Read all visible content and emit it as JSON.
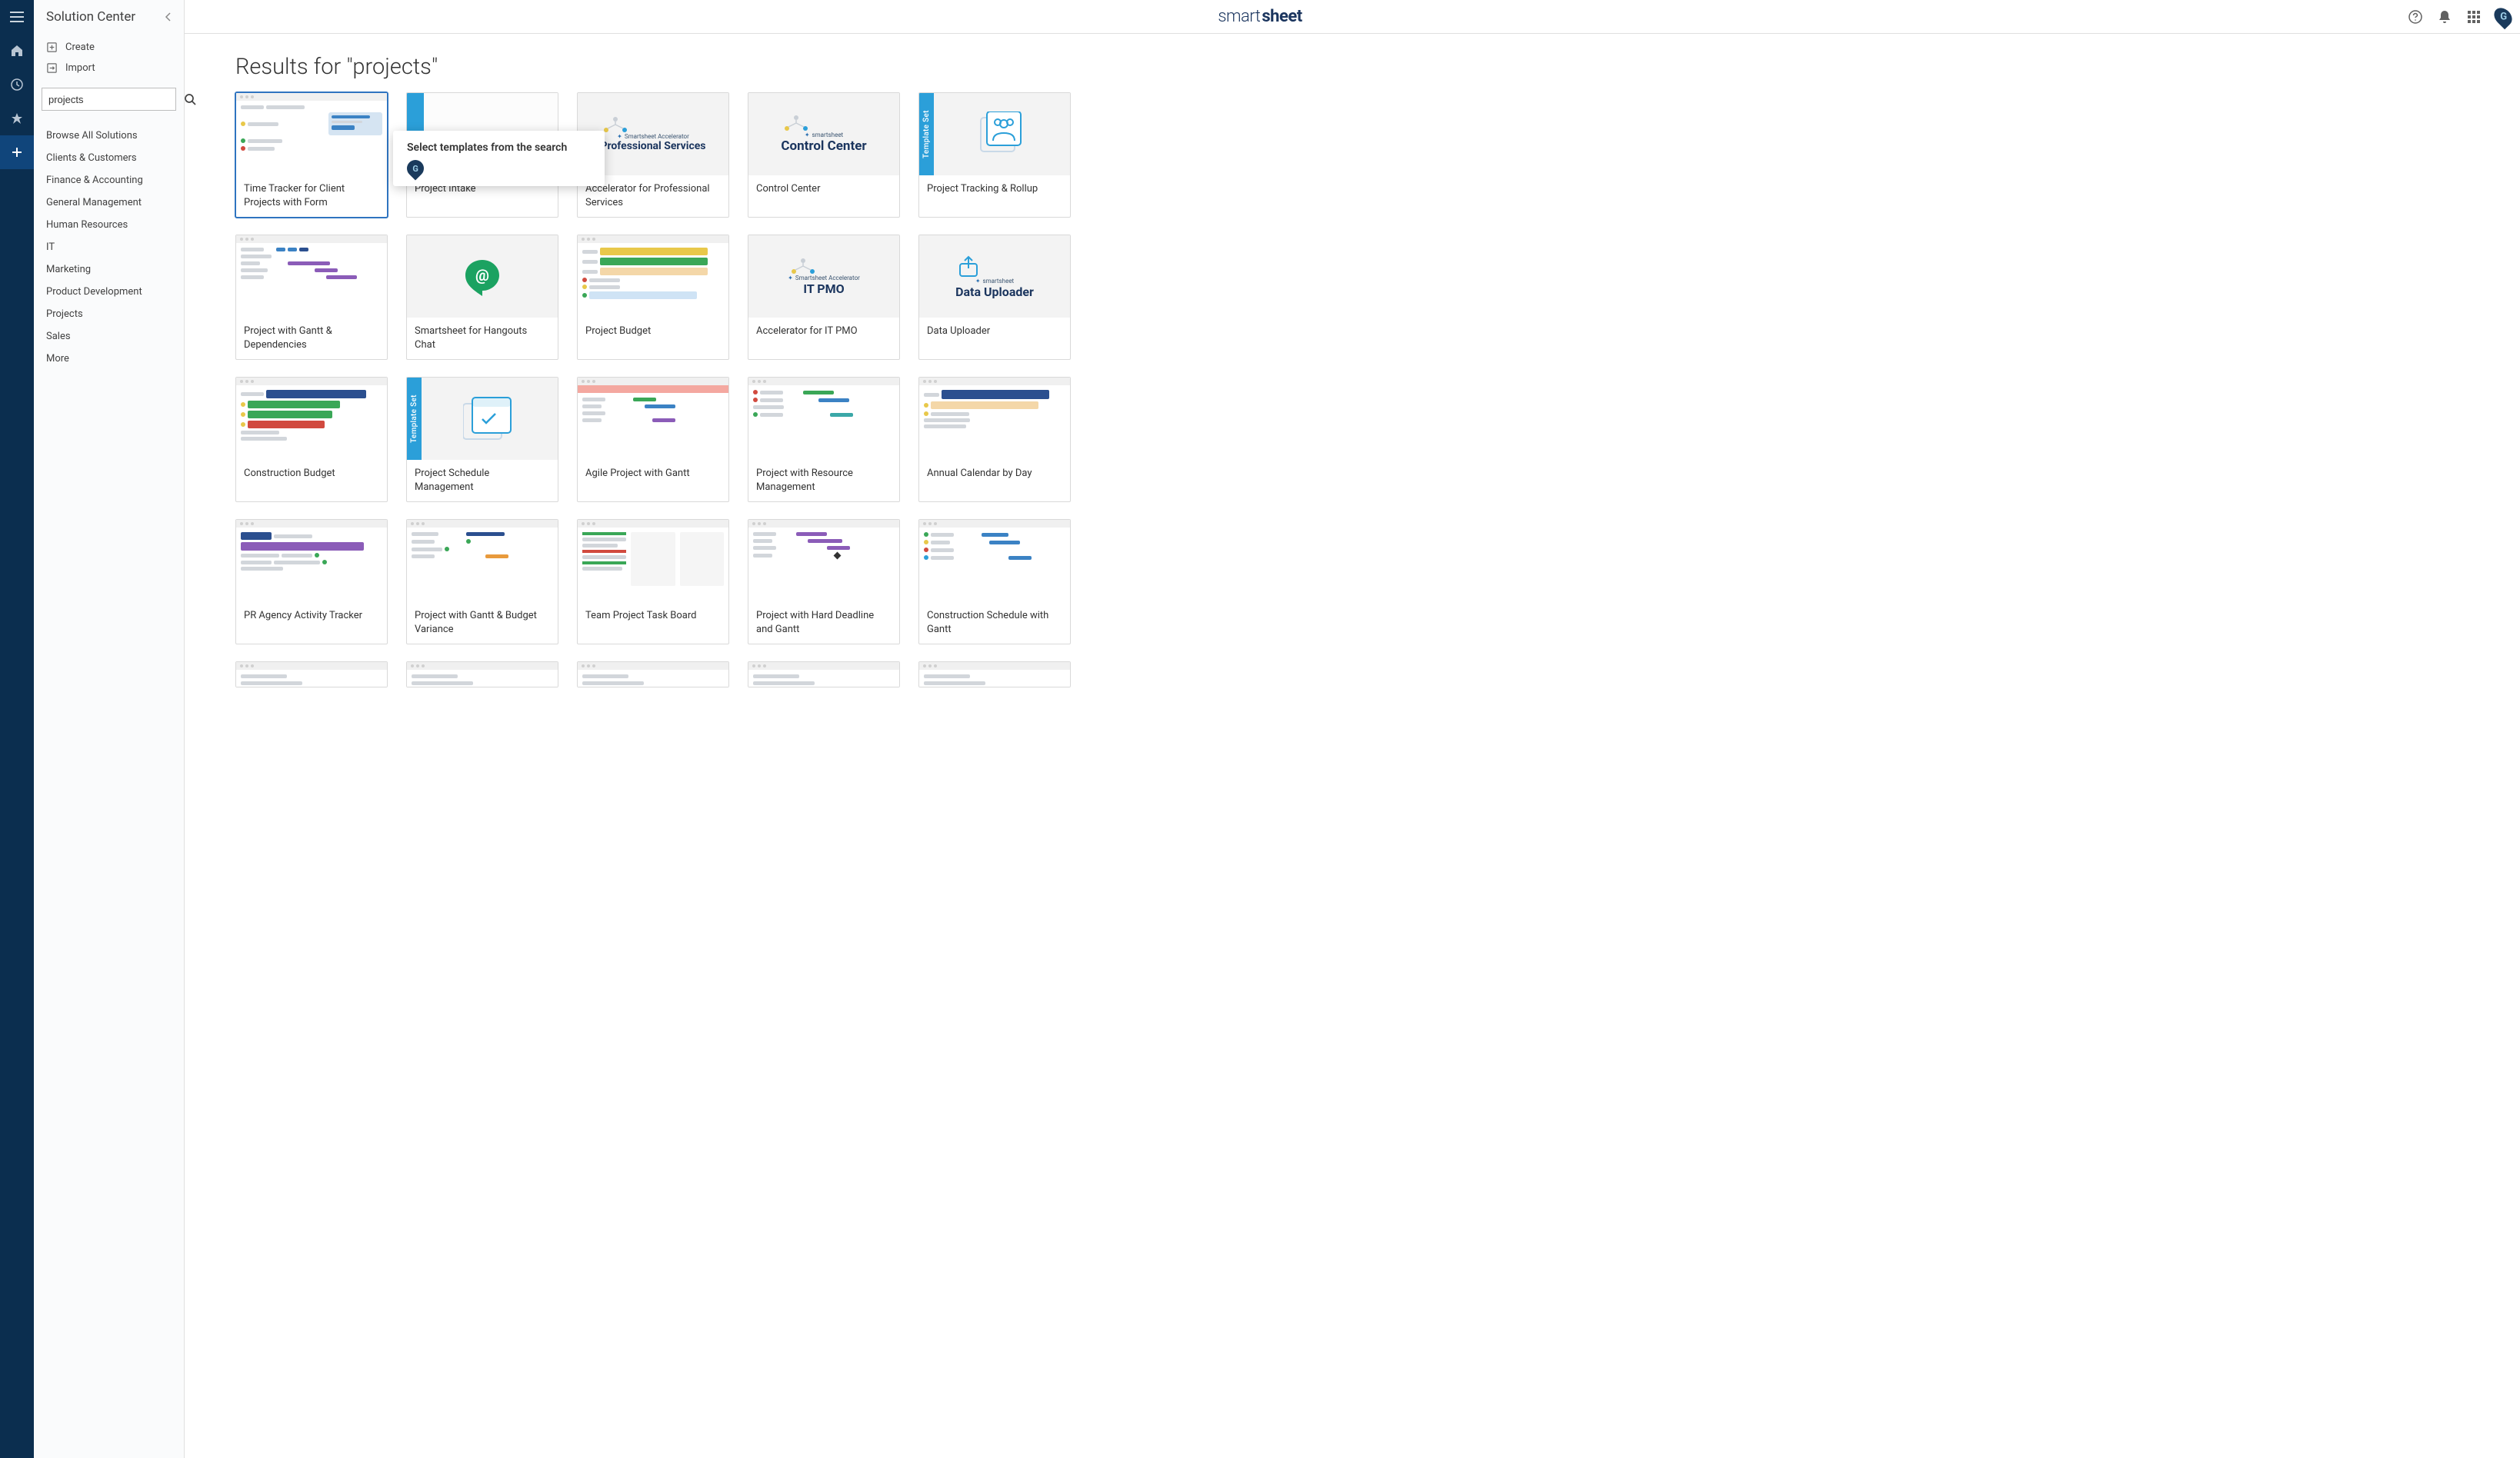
{
  "app": {
    "name": "smartsheet"
  },
  "sidebar": {
    "title": "Solution Center",
    "create_label": "Create",
    "import_label": "Import",
    "search_value": "projects",
    "categories": [
      "Browse All Solutions",
      "Clients & Customers",
      "Finance & Accounting",
      "General Management",
      "Human Resources",
      "IT",
      "Marketing",
      "Product Development",
      "Projects",
      "Sales",
      "More"
    ]
  },
  "main": {
    "results_heading": "Results for \"projects\"",
    "template_set_label": "Template Set"
  },
  "callout": {
    "text": "Select templates from the search"
  },
  "cards": [
    {
      "title": "Time Tracker for Client Projects with Form",
      "selected": true,
      "thumb": "sheet-blue",
      "template_set": false
    },
    {
      "title": "Project Intake",
      "thumb": "blue-strip",
      "template_set": false
    },
    {
      "title": "Accelerator for Professional Services",
      "thumb": "accel-ps",
      "template_set": false
    },
    {
      "title": "Control Center",
      "thumb": "control-center",
      "template_set": false
    },
    {
      "title": "Project Tracking & Rollup",
      "thumb": "people-icon",
      "template_set": true
    },
    {
      "title": "Project with Gantt & Dependencies",
      "thumb": "gantt-purple",
      "template_set": false
    },
    {
      "title": "Smartsheet for Hangouts Chat",
      "thumb": "hangouts",
      "template_set": false
    },
    {
      "title": "Project Budget",
      "thumb": "budget-rows",
      "template_set": false
    },
    {
      "title": "Accelerator for IT PMO",
      "thumb": "accel-itpmo",
      "template_set": false
    },
    {
      "title": "Data Uploader",
      "thumb": "data-uploader",
      "template_set": false
    },
    {
      "title": "Construction Budget",
      "thumb": "construction",
      "template_set": false
    },
    {
      "title": "Project Schedule Management",
      "thumb": "calendar-icon",
      "template_set": true
    },
    {
      "title": "Agile Project with Gantt",
      "thumb": "agile-gantt",
      "template_set": false
    },
    {
      "title": "Project with Resource Management",
      "thumb": "gantt-resource",
      "template_set": false
    },
    {
      "title": "Annual Calendar by Day",
      "thumb": "calendar-day",
      "template_set": false
    },
    {
      "title": "PR Agency Activity Tracker",
      "thumb": "pr-purple",
      "template_set": false
    },
    {
      "title": "Project with Gantt & Budget Variance",
      "thumb": "gantt-budget",
      "template_set": false
    },
    {
      "title": "Team Project Task Board",
      "thumb": "task-board",
      "template_set": false
    },
    {
      "title": "Project with Hard Deadline and Gantt",
      "thumb": "gantt-deadline",
      "template_set": false
    },
    {
      "title": "Construction Schedule with Gantt",
      "thumb": "gantt-construction",
      "template_set": false
    },
    {
      "title": "",
      "thumb": "blank1",
      "template_set": false
    },
    {
      "title": "",
      "thumb": "blank2",
      "template_set": false
    },
    {
      "title": "",
      "thumb": "blank3",
      "template_set": false
    },
    {
      "title": "",
      "thumb": "blank4",
      "template_set": false
    },
    {
      "title": "",
      "thumb": "blank5",
      "template_set": false
    }
  ]
}
